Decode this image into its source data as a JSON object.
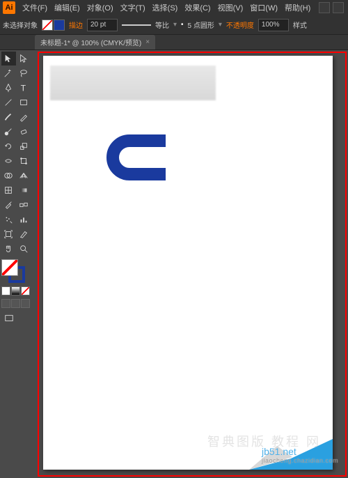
{
  "app": {
    "logo": "Ai"
  },
  "menu": {
    "file": "文件(F)",
    "edit": "编辑(E)",
    "object": "对象(O)",
    "type": "文字(T)",
    "select": "选择(S)",
    "effect": "效果(C)",
    "view": "视图(V)",
    "window": "窗口(W)",
    "help": "帮助(H)"
  },
  "control": {
    "noselect": "未选择对象",
    "stroke_label": "描边",
    "stroke_value": "20 pt",
    "uniform": "等比",
    "profile": "5 点圆形",
    "opacity_label": "不透明度",
    "opacity_value": "100%",
    "style": "样式"
  },
  "tab": {
    "title": "未标题-1* @ 100% (CMYK/预览)"
  },
  "tools": {
    "selection": "selection",
    "direct": "direct-selection",
    "wand": "magic-wand",
    "lasso": "lasso",
    "pen": "pen",
    "type": "type",
    "line": "line-segment",
    "rect": "rectangle",
    "brush": "paintbrush",
    "pencil": "pencil",
    "blob": "blob-brush",
    "eraser": "eraser",
    "rotate": "rotate",
    "scale": "scale",
    "width": "width",
    "warp": "warp",
    "shapebuilder": "shape-builder",
    "perspective": "perspective",
    "mesh": "mesh",
    "gradient": "gradient",
    "eyedrop": "eyedropper",
    "blend": "blend",
    "symbol": "symbol-sprayer",
    "graph": "column-graph",
    "artboard": "artboard",
    "slice": "slice",
    "hand": "hand",
    "zoom": "zoom"
  },
  "watermark": {
    "cn": "智典图版 教程 网",
    "site": "jb51.net",
    "sub": "jiaocheng.chazidian.com"
  },
  "colors": {
    "accent": "#ff7700",
    "strokecolor": "#1a3a9e"
  }
}
